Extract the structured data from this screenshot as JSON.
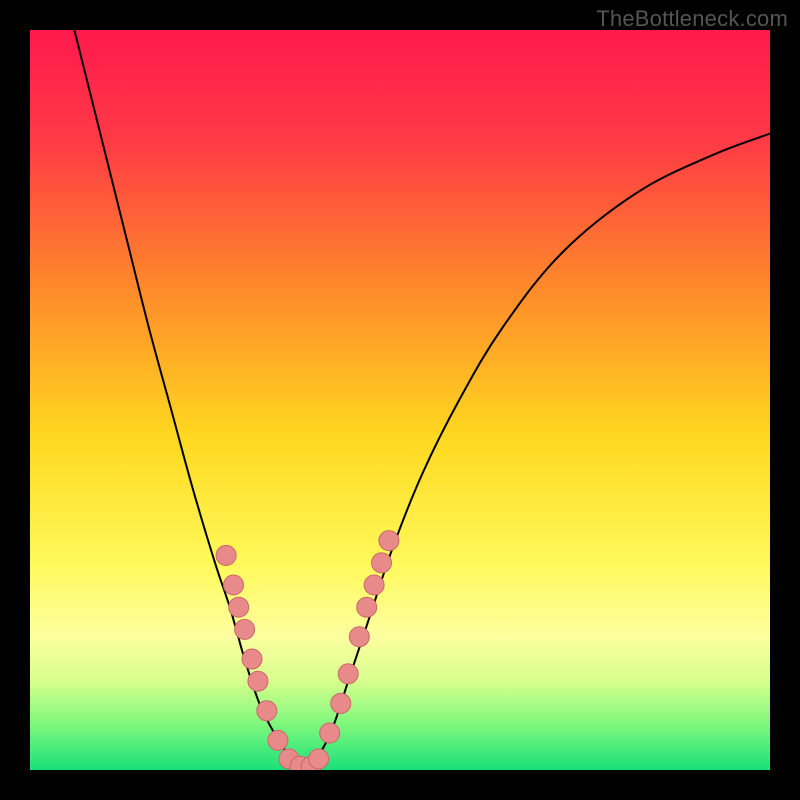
{
  "watermark": "TheBottleneck.com",
  "chart_data": {
    "type": "line",
    "title": "",
    "xlabel": "",
    "ylabel": "",
    "xlim": [
      0,
      100
    ],
    "ylim": [
      0,
      100
    ],
    "background_gradient_stops": [
      {
        "offset": 0.0,
        "color": "#ff1a4d"
      },
      {
        "offset": 0.15,
        "color": "#ff3a45"
      },
      {
        "offset": 0.35,
        "color": "#ff8a2a"
      },
      {
        "offset": 0.55,
        "color": "#ffd820"
      },
      {
        "offset": 0.72,
        "color": "#fff95a"
      },
      {
        "offset": 0.82,
        "color": "#fdffa0"
      },
      {
        "offset": 0.88,
        "color": "#d6ff8c"
      },
      {
        "offset": 0.94,
        "color": "#7cf77c"
      },
      {
        "offset": 1.0,
        "color": "#19e07a"
      }
    ],
    "series": [
      {
        "name": "left-curve",
        "stroke": "#000000",
        "points": [
          {
            "x": 6,
            "y": 100
          },
          {
            "x": 8,
            "y": 92
          },
          {
            "x": 10,
            "y": 84
          },
          {
            "x": 13,
            "y": 72
          },
          {
            "x": 16,
            "y": 60
          },
          {
            "x": 19,
            "y": 49
          },
          {
            "x": 22,
            "y": 38
          },
          {
            "x": 25,
            "y": 28
          },
          {
            "x": 27,
            "y": 22
          },
          {
            "x": 29,
            "y": 15
          },
          {
            "x": 31,
            "y": 9
          },
          {
            "x": 33,
            "y": 5
          },
          {
            "x": 35,
            "y": 2
          },
          {
            "x": 37,
            "y": 0.5
          }
        ]
      },
      {
        "name": "right-curve",
        "stroke": "#000000",
        "points": [
          {
            "x": 37,
            "y": 0.5
          },
          {
            "x": 39,
            "y": 2
          },
          {
            "x": 41,
            "y": 6
          },
          {
            "x": 43,
            "y": 12
          },
          {
            "x": 46,
            "y": 21
          },
          {
            "x": 49,
            "y": 30
          },
          {
            "x": 53,
            "y": 40
          },
          {
            "x": 58,
            "y": 50
          },
          {
            "x": 64,
            "y": 60
          },
          {
            "x": 72,
            "y": 70
          },
          {
            "x": 82,
            "y": 78
          },
          {
            "x": 92,
            "y": 83
          },
          {
            "x": 100,
            "y": 86
          }
        ]
      }
    ],
    "scatter": {
      "name": "marker-points",
      "fill": "#e88a8a",
      "stroke": "#c96868",
      "r": 10,
      "points": [
        {
          "x": 26.5,
          "y": 29
        },
        {
          "x": 27.5,
          "y": 25
        },
        {
          "x": 28.2,
          "y": 22
        },
        {
          "x": 29.0,
          "y": 19
        },
        {
          "x": 30.0,
          "y": 15
        },
        {
          "x": 30.8,
          "y": 12
        },
        {
          "x": 32.0,
          "y": 8
        },
        {
          "x": 33.5,
          "y": 4
        },
        {
          "x": 35.0,
          "y": 1.5
        },
        {
          "x": 36.5,
          "y": 0.5
        },
        {
          "x": 38.0,
          "y": 0.5
        },
        {
          "x": 39.0,
          "y": 1.5
        },
        {
          "x": 40.5,
          "y": 5
        },
        {
          "x": 42.0,
          "y": 9
        },
        {
          "x": 43.0,
          "y": 13
        },
        {
          "x": 44.5,
          "y": 18
        },
        {
          "x": 45.5,
          "y": 22
        },
        {
          "x": 46.5,
          "y": 25
        },
        {
          "x": 47.5,
          "y": 28
        },
        {
          "x": 48.5,
          "y": 31
        }
      ]
    }
  }
}
